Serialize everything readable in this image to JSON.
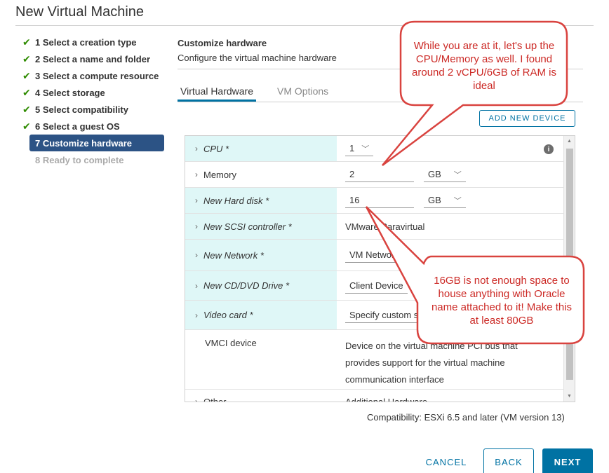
{
  "window": {
    "title": "New Virtual Machine"
  },
  "steps": [
    {
      "label": "1 Select a creation type",
      "state": "done"
    },
    {
      "label": "2 Select a name and folder",
      "state": "done"
    },
    {
      "label": "3 Select a compute resource",
      "state": "done"
    },
    {
      "label": "4 Select storage",
      "state": "done"
    },
    {
      "label": "5 Select compatibility",
      "state": "done"
    },
    {
      "label": "6 Select a guest OS",
      "state": "done"
    },
    {
      "label": "7 Customize hardware",
      "state": "active"
    },
    {
      "label": "8 Ready to complete",
      "state": "disabled"
    }
  ],
  "header": {
    "title": "Customize hardware",
    "subtitle": "Configure the virtual machine hardware"
  },
  "tabs": [
    {
      "label": "Virtual Hardware",
      "active": true
    },
    {
      "label": "VM Options",
      "active": false
    }
  ],
  "add_device_label": "ADD NEW DEVICE",
  "hardware": {
    "cpu": {
      "label": "CPU *",
      "value": "1"
    },
    "memory": {
      "label": "Memory",
      "value": "2",
      "unit": "GB"
    },
    "hard_disk": {
      "label": "New Hard disk *",
      "value": "16",
      "unit": "GB"
    },
    "scsi": {
      "label": "New SCSI controller *",
      "value": "VMware Paravirtual"
    },
    "network": {
      "label": "New Network *",
      "value": "VM Network"
    },
    "cd_dvd": {
      "label": "New CD/DVD Drive *",
      "value": "Client Device"
    },
    "video": {
      "label": "Video card *",
      "value": "Specify custom se"
    },
    "vmci": {
      "label": "VMCI device",
      "value_lines": [
        "Device on the virtual machine PCI bus that",
        "provides support for the virtual machine",
        "communication interface"
      ]
    },
    "other": {
      "label": "Other",
      "value": "Additional Hardware"
    }
  },
  "compatibility": "Compatibility: ESXi 6.5 and later (VM version 13)",
  "footer": {
    "cancel": "CANCEL",
    "back": "BACK",
    "next": "NEXT"
  },
  "callouts": {
    "cpu_memory": "While you are at it, let's up the CPU/Memory as well. I found around 2 vCPU/6GB of RAM is ideal",
    "disk": "16GB is not enough space to house anything with Oracle name attached to it! Make this at least 80GB"
  },
  "colors": {
    "accent": "#0072a3",
    "active_step": "#2c5385",
    "highlight_row": "#dff7f7",
    "callout": "#d9433f",
    "check": "#2e8b00"
  }
}
